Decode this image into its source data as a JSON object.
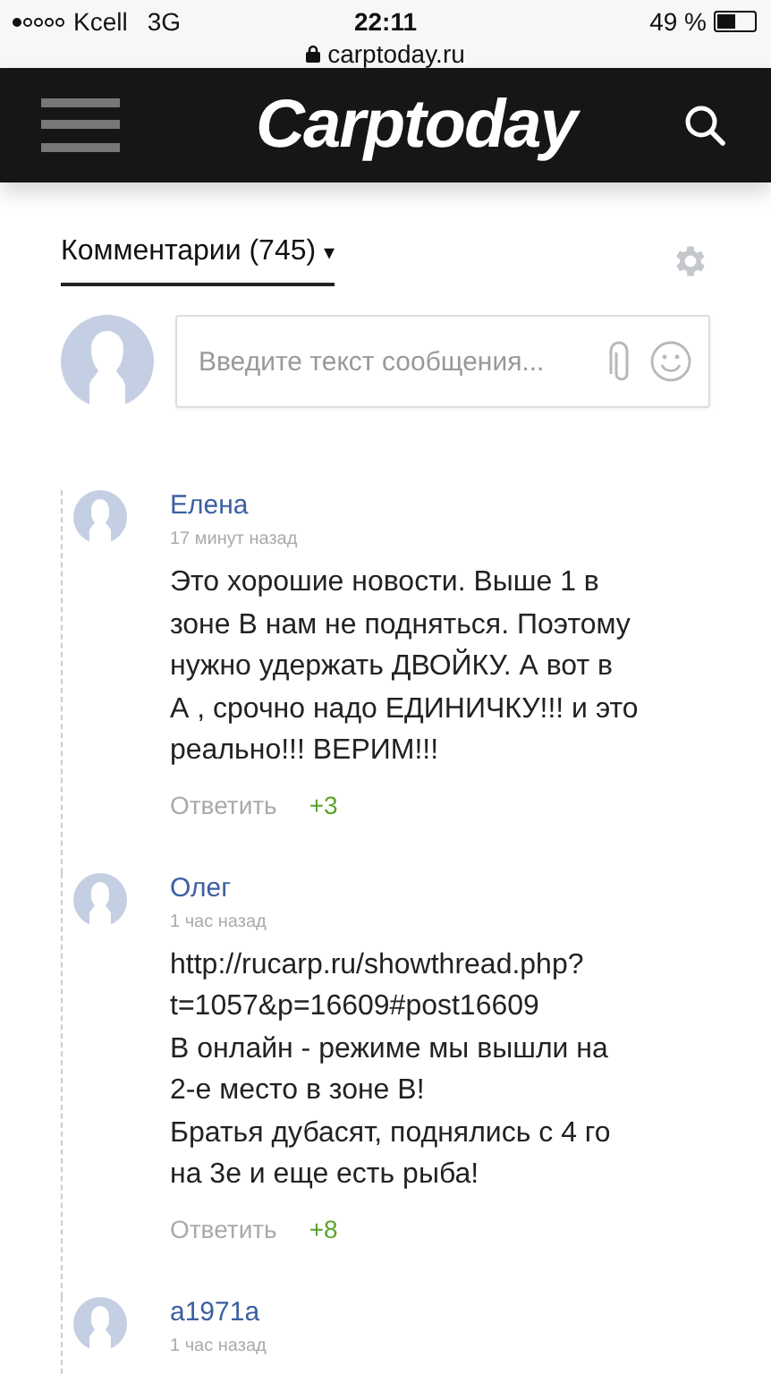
{
  "status_bar": {
    "carrier": "Kcell",
    "network": "3G",
    "time": "22:11",
    "battery": "49 %"
  },
  "address_bar": {
    "url": "carptoday.ru"
  },
  "header": {
    "logo": "Carptoday"
  },
  "comments_header": {
    "title": "Комментарии (745)",
    "arrow": "▾"
  },
  "composer": {
    "placeholder": "Введите текст сообщения..."
  },
  "comments": [
    {
      "author": "Елена",
      "time": "17 минут назад",
      "body": "Это хорошие новости. Выше 1 в зоне В нам не подняться. Поэтому нужно удержать ДВОЙКУ. А вот в А , срочно надо ЕДИНИЧКУ!!! и это реально!!! ВЕРИМ!!!",
      "reply": "Ответить",
      "score": "+3"
    },
    {
      "author": "Олег",
      "time": "1 час назад",
      "body": "http://rucarp.ru/showthread.php?t=1057&p=16609#post16609\nВ онлайн - режиме мы вышли на 2-е место в зоне В!\nБратья дубасят, поднялись с 4 го на 3е и еще есть рыба!",
      "reply": "Ответить",
      "score": "+8"
    },
    {
      "author": "a1971a",
      "time": "1 час назад"
    }
  ]
}
